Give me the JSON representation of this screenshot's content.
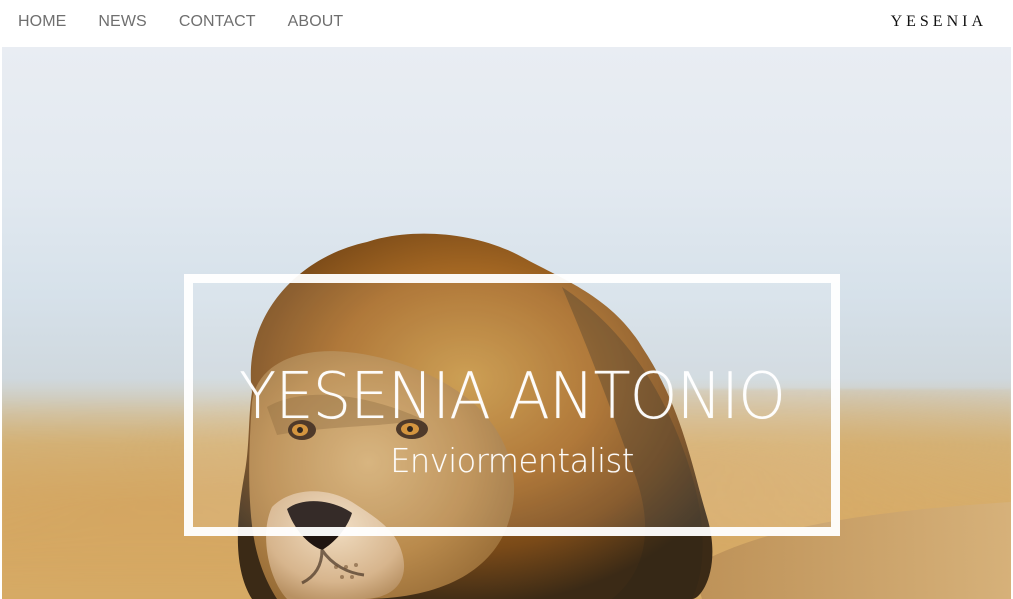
{
  "nav": {
    "items": [
      {
        "label": "HOME"
      },
      {
        "label": "NEWS"
      },
      {
        "label": "CONTACT"
      },
      {
        "label": "ABOUT"
      }
    ],
    "brand": "YESENIA"
  },
  "hero": {
    "name": "YESENIA ANTONIO",
    "role": "Enviormentalist",
    "image_subject": "lion"
  },
  "colors": {
    "nav_text": "#6f6f6f",
    "brand_text": "#111111",
    "box_border": "#ffffff"
  }
}
